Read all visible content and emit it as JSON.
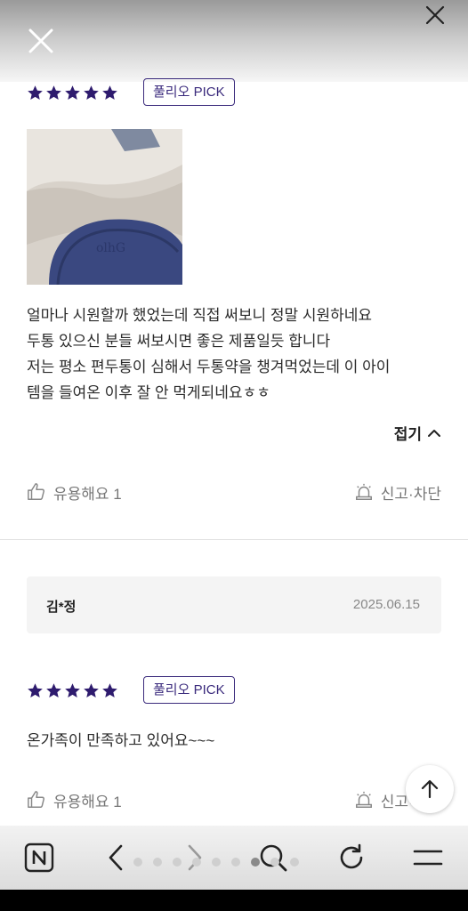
{
  "review1": {
    "rating": 5,
    "badge": "풀리오 PICK",
    "lines": [
      "얼마나 시원할까 했었는데 직접 써보니 정말 시원하네요",
      "두통 있으신 분들 써보시면 좋은 제품일듯 합니다",
      "저는 평소 편두통이 심해서 두통약을 챙겨먹었는데 이 아이",
      "템을 들여온 이후 잘 안 먹게되네요ㅎㅎ"
    ],
    "collapse_label": "접기",
    "helpful_label": "유용해요 1",
    "report_label": "신고·차단"
  },
  "review2": {
    "author": "김*정",
    "date": "2025.06.15",
    "rating": 5,
    "badge": "풀리오 PICK",
    "text": "온가족이 만족하고 있어요~~~",
    "helpful_label": "유용해요 1",
    "report_label": "신고·차단"
  },
  "colors": {
    "accent": "#2e1b6e",
    "badge": "#3a2a7c"
  },
  "bottom_nav": {
    "icons": [
      "naver-home-icon",
      "back-arrow-icon",
      "forward-arrow-icon",
      "search-icon",
      "refresh-icon",
      "menu-icon"
    ],
    "pages_total": 9,
    "current_page": 7
  }
}
